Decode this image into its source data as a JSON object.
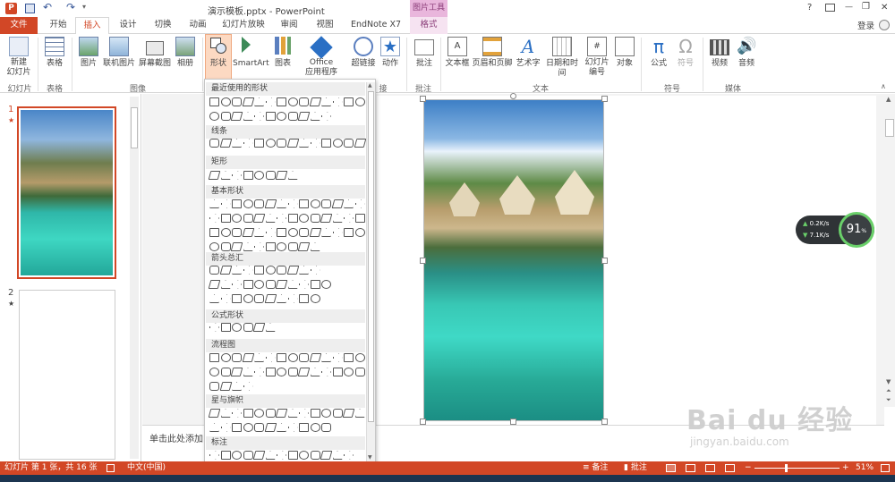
{
  "window": {
    "title": "演示模板.pptx - PowerPoint",
    "contextual_tab": "图片工具",
    "help": "?",
    "minimize": "—",
    "restore": "❐",
    "close": "✕",
    "login": "登录",
    "qat": [
      "save",
      "undo",
      "redo"
    ]
  },
  "tabs": [
    "文件",
    "开始",
    "插入",
    "设计",
    "切换",
    "动画",
    "幻灯片放映",
    "审阅",
    "视图",
    "EndNote X7",
    "格式"
  ],
  "ribbon": {
    "buttons": [
      {
        "label": "新建\n幻灯片",
        "icon": "new-slide-icon"
      },
      {
        "label": "表格",
        "icon": "table-icon"
      },
      {
        "label": "图片",
        "icon": "picture-icon"
      },
      {
        "label": "联机图片",
        "icon": "online-picture-icon"
      },
      {
        "label": "屏幕截图",
        "icon": "screenshot-icon"
      },
      {
        "label": "相册",
        "icon": "album-icon"
      },
      {
        "label": "形状",
        "icon": "shapes-icon"
      },
      {
        "label": "SmartArt",
        "icon": "smartart-icon"
      },
      {
        "label": "图表",
        "icon": "chart-icon"
      },
      {
        "label": "Office\n应用程序",
        "icon": "office-apps-icon"
      },
      {
        "label": "超链接",
        "icon": "hyperlink-icon"
      },
      {
        "label": "动作",
        "icon": "action-icon"
      },
      {
        "label": "批注",
        "icon": "comment-icon"
      },
      {
        "label": "文本框",
        "icon": "textbox-icon"
      },
      {
        "label": "页眉和页脚",
        "icon": "header-footer-icon"
      },
      {
        "label": "艺术字",
        "icon": "wordart-icon"
      },
      {
        "label": "日期和时间",
        "icon": "datetime-icon"
      },
      {
        "label": "幻灯片\n编号",
        "icon": "slide-number-icon"
      },
      {
        "label": "对象",
        "icon": "object-icon"
      },
      {
        "label": "公式",
        "icon": "equation-icon"
      },
      {
        "label": "符号",
        "icon": "symbol-icon"
      },
      {
        "label": "视频",
        "icon": "video-icon"
      },
      {
        "label": "音频",
        "icon": "audio-icon"
      }
    ],
    "groups": [
      "幻灯片",
      "表格",
      "图像",
      "接",
      "批注",
      "文本",
      "符号",
      "媒体"
    ]
  },
  "shapes_menu": {
    "sections": [
      "最近使用的形状",
      "线条",
      "矩形",
      "基本形状",
      "箭头总汇",
      "公式形状",
      "流程图",
      "星与旗帜",
      "标注"
    ]
  },
  "slides": [
    {
      "number": "1",
      "marker": "★"
    },
    {
      "number": "2",
      "marker": "★"
    }
  ],
  "notes_placeholder": "单击此处添加",
  "speed_widget": {
    "up": "0.2K/s",
    "down": "7.1K/s",
    "percent": "91",
    "unit": "%"
  },
  "watermark": {
    "brand": "Bai du 经验",
    "url": "jingyan.baidu.com"
  },
  "status": {
    "slide_info": "幻灯片 第 1 张，共 16 张",
    "language": "中文(中国)",
    "notes": "备注",
    "comments": "批注",
    "zoom": "51%"
  },
  "colors": {
    "accent": "#d24726",
    "contextual": "#e9b6dc"
  }
}
